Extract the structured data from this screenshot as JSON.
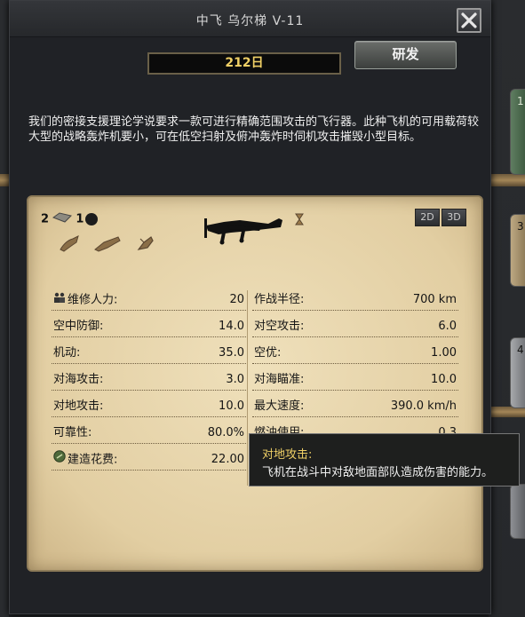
{
  "window": {
    "title": "中飞 乌尔梯 V-11",
    "research_days": "212日",
    "research_button": "研发",
    "description": "我们的密接支援理论学说要求一款可进行精确范围攻击的飞行器。此种飞机的可用载荷较大型的战略轰炸机要小，可在低空扫射及俯冲轰炸时伺机攻击摧毁小型目标。"
  },
  "background_tiles": [
    "1",
    "3",
    "4"
  ],
  "card": {
    "crew": {
      "left_count": "2",
      "right_count": "1"
    },
    "view_toggle": [
      "2D",
      "3D"
    ],
    "icons": [
      "equipment-icon",
      "engine-module-icon",
      "weapon-module-icon",
      "bomb-module-icon",
      "aircraft-silhouette-icon",
      "hourglass-icon"
    ],
    "stats_left": [
      {
        "label": "维修人力:",
        "value": "20",
        "icon": "manpower-icon"
      },
      {
        "label": "空中防御:",
        "value": "14.0"
      },
      {
        "label": "机动:",
        "value": "35.0"
      },
      {
        "label": "对海攻击:",
        "value": "3.0"
      },
      {
        "label": "对地攻击:",
        "value": "10.0"
      },
      {
        "label": "可靠性:",
        "value": "80.0%"
      },
      {
        "label": "建造花费:",
        "value": "22.00",
        "icon": "production-cost-icon"
      }
    ],
    "stats_right": [
      {
        "label": "作战半径:",
        "value": "700 km"
      },
      {
        "label": "对空攻击:",
        "value": "6.0"
      },
      {
        "label": "空优:",
        "value": "1.00"
      },
      {
        "label": "对海瞄准:",
        "value": "10.0"
      },
      {
        "label": "最大速度:",
        "value": "390.0 km/h"
      },
      {
        "label": "燃油使用:",
        "value": "0.3"
      }
    ]
  },
  "tooltip": {
    "title": "对地攻击:",
    "body": "飞机在战斗中对敌地面部队造成伤害的能力。"
  },
  "colors": {
    "gold_text": "#f0d066",
    "parchment": "#e8d7b0"
  }
}
